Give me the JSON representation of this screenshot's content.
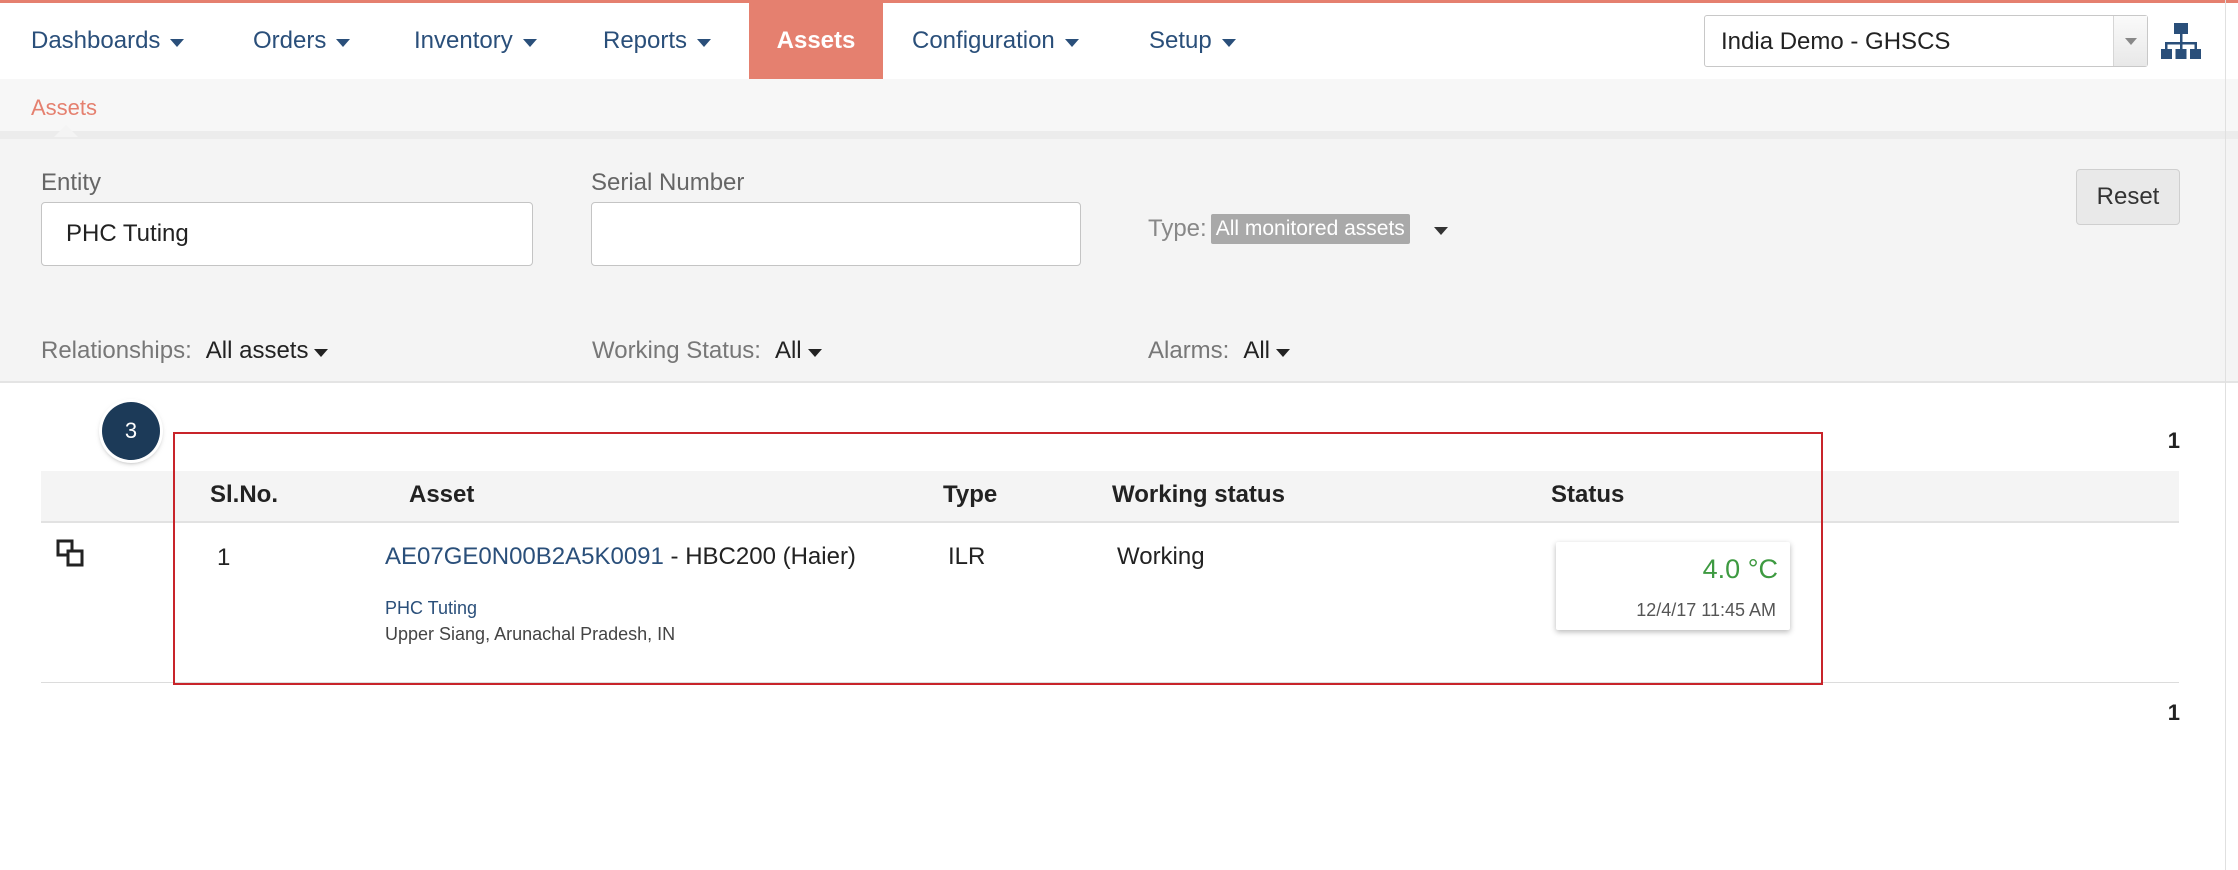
{
  "nav": {
    "items": [
      {
        "label": "Dashboards",
        "dropdown": true
      },
      {
        "label": "Orders",
        "dropdown": true
      },
      {
        "label": "Inventory",
        "dropdown": true
      },
      {
        "label": "Reports",
        "dropdown": true
      },
      {
        "label": "Assets",
        "dropdown": false,
        "active": true
      },
      {
        "label": "Configuration",
        "dropdown": true
      },
      {
        "label": "Setup",
        "dropdown": true
      }
    ],
    "domain_select": "India Demo - GHSCS",
    "org_icon": "hierarchy-icon",
    "accent_color": "#e5806f",
    "link_color": "#2a4f7a"
  },
  "breadcrumb": {
    "current": "Assets"
  },
  "filters": {
    "entity_label": "Entity",
    "entity_value": "PHC Tuting",
    "serial_label": "Serial Number",
    "serial_value": "",
    "type_label": "Type:",
    "type_value": "All monitored assets",
    "reset_label": "Reset",
    "relationships_label": "Relationships:",
    "relationships_value": "All assets",
    "working_status_label": "Working Status:",
    "working_status_value": "All",
    "alarms_label": "Alarms:",
    "alarms_value": "All"
  },
  "step_badge": "3",
  "pagination": {
    "page": "1"
  },
  "table": {
    "headers": [
      "Sl.No.",
      "Asset",
      "Type",
      "Working status",
      "Status"
    ],
    "rows": [
      {
        "sl_no": "1",
        "asset_id": "AE07GE0N00B2A5K0091",
        "asset_model": " - HBC200 (Haier)",
        "entity": "PHC Tuting",
        "location": "Upper Siang, Arunachal Pradesh, IN",
        "type": "ILR",
        "working_status": "Working",
        "temperature": "4.0 °C",
        "timestamp": "12/4/17 11:45 AM",
        "temperature_color": "#3e9a41"
      }
    ]
  }
}
